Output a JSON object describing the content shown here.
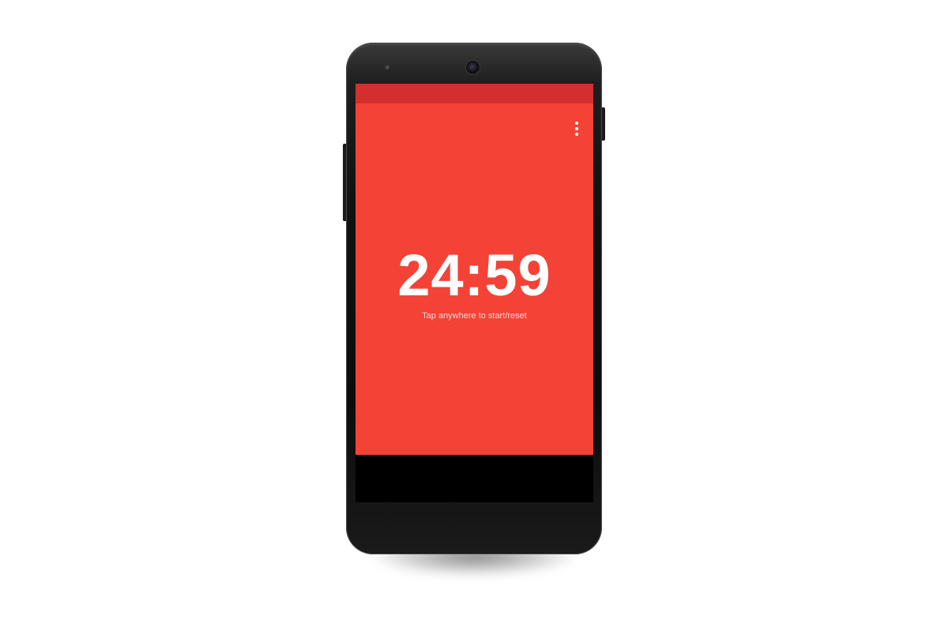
{
  "app": {
    "background_color": "#f44236",
    "status_bar_color": "#d32f2f"
  },
  "toolbar": {
    "overflow_icon": "more-vert-icon"
  },
  "timer": {
    "display": "24:59",
    "hint": "Tap anywhere to start/reset"
  }
}
